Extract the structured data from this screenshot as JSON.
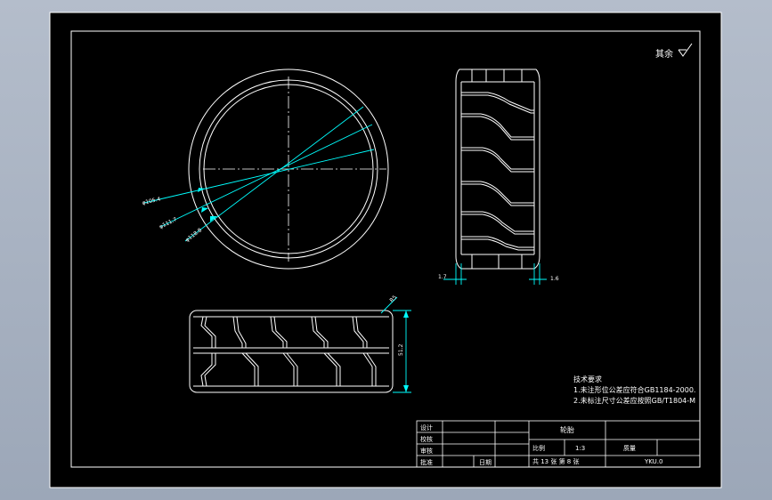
{
  "colors": {
    "background": "#a7b1c2",
    "paper": "#000000",
    "lines": "#ffffff",
    "leaders": "#00ffff",
    "dimension_text": "#ffffff"
  },
  "roughness_note": "其余",
  "dimensions": {
    "dia_inner": "φ105.4",
    "dia_mid": "φ111.7",
    "dia_outer": "φ118.8",
    "width_left": "1.7",
    "width_right": "1.6",
    "height": "51.2",
    "corner": "R5"
  },
  "tech_requirements": {
    "title": "技术要求",
    "line1": "1.未注形位公差应符合GB1184-2000.",
    "line2": "2.未标注尺寸公差应按照GB/T1804-M"
  },
  "title_block": {
    "design": "设计",
    "check": "校核",
    "review": "审核",
    "approve": "批准",
    "date_label": "日期",
    "part_name": "轮胎",
    "scale_label": "比例",
    "scale_value": "1:3",
    "sheet_info": "共 13 张 第 8 张",
    "weight_label": "质量",
    "material": "YKU.0"
  }
}
